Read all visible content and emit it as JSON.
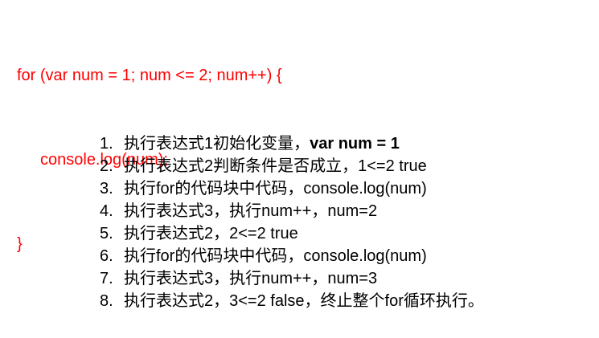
{
  "code": {
    "lines": [
      "for (var num = 1; num <= 2; num++) {",
      "console.log(num);",
      "}"
    ]
  },
  "steps": [
    {
      "num": "1.",
      "text": "执行表达式1初始化变量，",
      "emph": "var num = 1"
    },
    {
      "num": "2.",
      "text": "执行表达式2判断条件是否成立，1<=2 true",
      "emph": ""
    },
    {
      "num": "3.",
      "text": "执行for的代码块中代码，console.log(num)",
      "emph": ""
    },
    {
      "num": "4.",
      "text": "执行表达式3，执行num++，num=2",
      "emph": ""
    },
    {
      "num": "5.",
      "text": "执行表达式2，2<=2 true",
      "emph": ""
    },
    {
      "num": "6.",
      "text": "执行for的代码块中代码，console.log(num)",
      "emph": ""
    },
    {
      "num": "7.",
      "text": "执行表达式3，执行num++，num=3",
      "emph": ""
    },
    {
      "num": "8.",
      "text": "执行表达式2，3<=2 false，终止整个for循环执行。",
      "emph": ""
    }
  ],
  "colors": {
    "code": "#ff0000",
    "text": "#000000",
    "background": "#ffffff"
  }
}
